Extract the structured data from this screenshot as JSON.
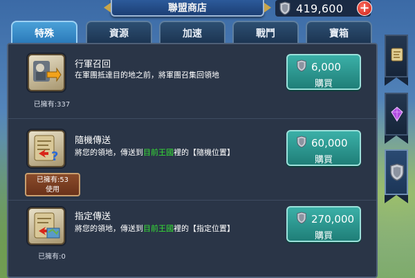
{
  "header": {
    "title": "聯盟商店",
    "currency_value": "419,600",
    "plus_label": "+"
  },
  "tabs": [
    {
      "label": "特殊",
      "active": true
    },
    {
      "label": "資源",
      "active": false
    },
    {
      "label": "加速",
      "active": false
    },
    {
      "label": "戰鬥",
      "active": false
    },
    {
      "label": "寶箱",
      "active": false
    }
  ],
  "items": [
    {
      "name": "行軍召回",
      "description": "在軍團抵達目的地之前，將軍團召集回領地",
      "owned": "已擁有:337",
      "price": "6,000",
      "buy_label": "購買"
    },
    {
      "name": "隨機傳送",
      "description_pre": "將您的領地，傳送到",
      "description_highlight": "目前王國",
      "description_post": "裡的【隨機位置】",
      "owned": "已擁有:53",
      "use_label": "使用",
      "price": "60,000",
      "buy_label": "購買"
    },
    {
      "name": "指定傳送",
      "description_pre": "將您的領地，傳送到",
      "description_highlight": "目前王國",
      "description_post": "裡的【指定位置】",
      "owned": "已擁有:0",
      "price": "270,000",
      "buy_label": "購買"
    }
  ],
  "colors": {
    "tab_active": "#2a78b8",
    "buy_button": "#1f7e78",
    "highlight_text": "#35e035",
    "panel_bg": "#2a3547"
  },
  "icons": [
    "shield-icon",
    "plus-icon",
    "march-recall-icon",
    "random-teleport-icon",
    "target-teleport-icon",
    "scroll-icon",
    "purple-gem-icon",
    "shield-side-icon"
  ]
}
